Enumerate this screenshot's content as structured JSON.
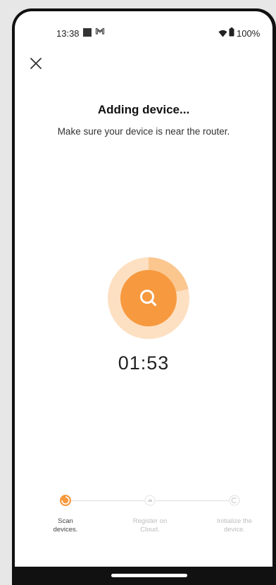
{
  "status_bar": {
    "time": "13:38",
    "battery_text": "100%"
  },
  "header": {
    "close_icon": "close-icon"
  },
  "main": {
    "title": "Adding device...",
    "subtitle": "Make sure your device is near the router.",
    "timer": "01:53",
    "scan_icon": "search-icon"
  },
  "steps": [
    {
      "line1": "Scan",
      "line2": "devices.",
      "state": "active"
    },
    {
      "line1": "Register on",
      "line2": "Cloud.",
      "state": "pending"
    },
    {
      "line1": "Initialize the",
      "line2": "device.",
      "state": "pending"
    }
  ],
  "colors": {
    "accent": "#f7993e",
    "accent_light": "#fbc78f",
    "accent_pale": "#fde0c2"
  }
}
